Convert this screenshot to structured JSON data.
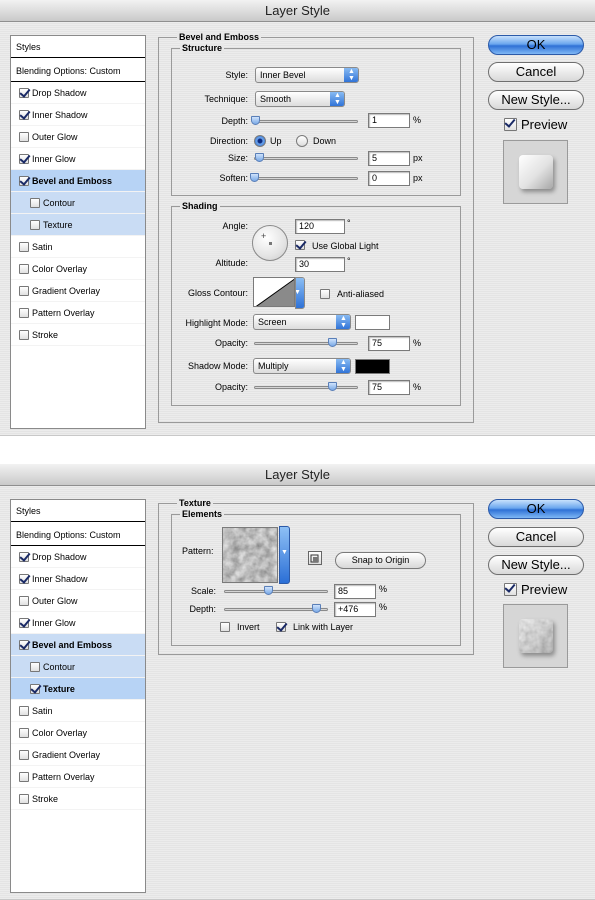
{
  "dialogs": [
    {
      "title": "Layer Style",
      "style_list": {
        "header": "Styles",
        "blending": "Blending Options: Custom",
        "items": [
          {
            "label": "Drop Shadow",
            "checked": true
          },
          {
            "label": "Inner Shadow",
            "checked": true
          },
          {
            "label": "Outer Glow",
            "checked": false
          },
          {
            "label": "Inner Glow",
            "checked": true
          },
          {
            "label": "Bevel and Emboss",
            "checked": true
          },
          {
            "label": "Contour",
            "checked": false
          },
          {
            "label": "Texture",
            "checked": false
          },
          {
            "label": "Satin",
            "checked": false
          },
          {
            "label": "Color Overlay",
            "checked": false
          },
          {
            "label": "Gradient Overlay",
            "checked": false
          },
          {
            "label": "Pattern Overlay",
            "checked": false
          },
          {
            "label": "Stroke",
            "checked": false
          }
        ]
      },
      "panel": {
        "title": "Bevel and Emboss",
        "structure": {
          "title": "Structure",
          "style_label": "Style:",
          "style_value": "Inner Bevel",
          "technique_label": "Technique:",
          "technique_value": "Smooth",
          "depth_label": "Depth:",
          "depth_value": "1",
          "depth_unit": "%",
          "depth_level": 0.01,
          "direction_label": "Direction:",
          "up_label": "Up",
          "down_label": "Down",
          "size_label": "Size:",
          "size_value": "5",
          "size_unit": "px",
          "size_level": 0.05,
          "soften_label": "Soften:",
          "soften_value": "0",
          "soften_unit": "px",
          "soften_level": 0
        },
        "shading": {
          "title": "Shading",
          "angle_label": "Angle:",
          "angle_value": "120",
          "angle_unit": "°",
          "global_light_label": "Use Global Light",
          "altitude_label": "Altitude:",
          "altitude_value": "30",
          "altitude_unit": "°",
          "gloss_label": "Gloss Contour:",
          "antialias_label": "Anti-aliased",
          "highlight_label": "Highlight Mode:",
          "highlight_value": "Screen",
          "highlight_color": "#ffffff",
          "opacity1_label": "Opacity:",
          "opacity1_value": "75",
          "opacity1_unit": "%",
          "opacity1_level": 0.75,
          "shadow_label": "Shadow Mode:",
          "shadow_value": "Multiply",
          "shadow_color": "#000000",
          "opacity2_label": "Opacity:",
          "opacity2_value": "75",
          "opacity2_unit": "%",
          "opacity2_level": 0.75
        }
      },
      "buttons": {
        "ok": "OK",
        "cancel": "Cancel",
        "new_style": "New Style...",
        "preview": "Preview"
      }
    },
    {
      "title": "Layer Style",
      "style_list": {
        "header": "Styles",
        "blending": "Blending Options: Custom",
        "items": [
          {
            "label": "Drop Shadow",
            "checked": true
          },
          {
            "label": "Inner Shadow",
            "checked": true
          },
          {
            "label": "Outer Glow",
            "checked": false
          },
          {
            "label": "Inner Glow",
            "checked": true
          },
          {
            "label": "Bevel and Emboss",
            "checked": true
          },
          {
            "label": "Contour",
            "checked": false
          },
          {
            "label": "Texture",
            "checked": true
          },
          {
            "label": "Satin",
            "checked": false
          },
          {
            "label": "Color Overlay",
            "checked": false
          },
          {
            "label": "Gradient Overlay",
            "checked": false
          },
          {
            "label": "Pattern Overlay",
            "checked": false
          },
          {
            "label": "Stroke",
            "checked": false
          }
        ]
      },
      "panel": {
        "title": "Texture",
        "elements": {
          "title": "Elements",
          "pattern_label": "Pattern:",
          "snap_label": "Snap to Origin",
          "scale_label": "Scale:",
          "scale_value": "85",
          "scale_unit": "%",
          "scale_level": 0.42,
          "depth_label": "Depth:",
          "depth_value": "+476",
          "depth_unit": "%",
          "depth_level": 0.88,
          "invert_label": "Invert",
          "link_label": "Link with Layer"
        }
      },
      "buttons": {
        "ok": "OK",
        "cancel": "Cancel",
        "new_style": "New Style...",
        "preview": "Preview"
      }
    }
  ],
  "icons": {
    "checkbox": "checkmark-icon",
    "dropdown": "updown-arrows-icon",
    "dial": "angle-dial-icon",
    "pattern": "stone-texture-pattern",
    "new_preset": "new-preset-icon"
  }
}
